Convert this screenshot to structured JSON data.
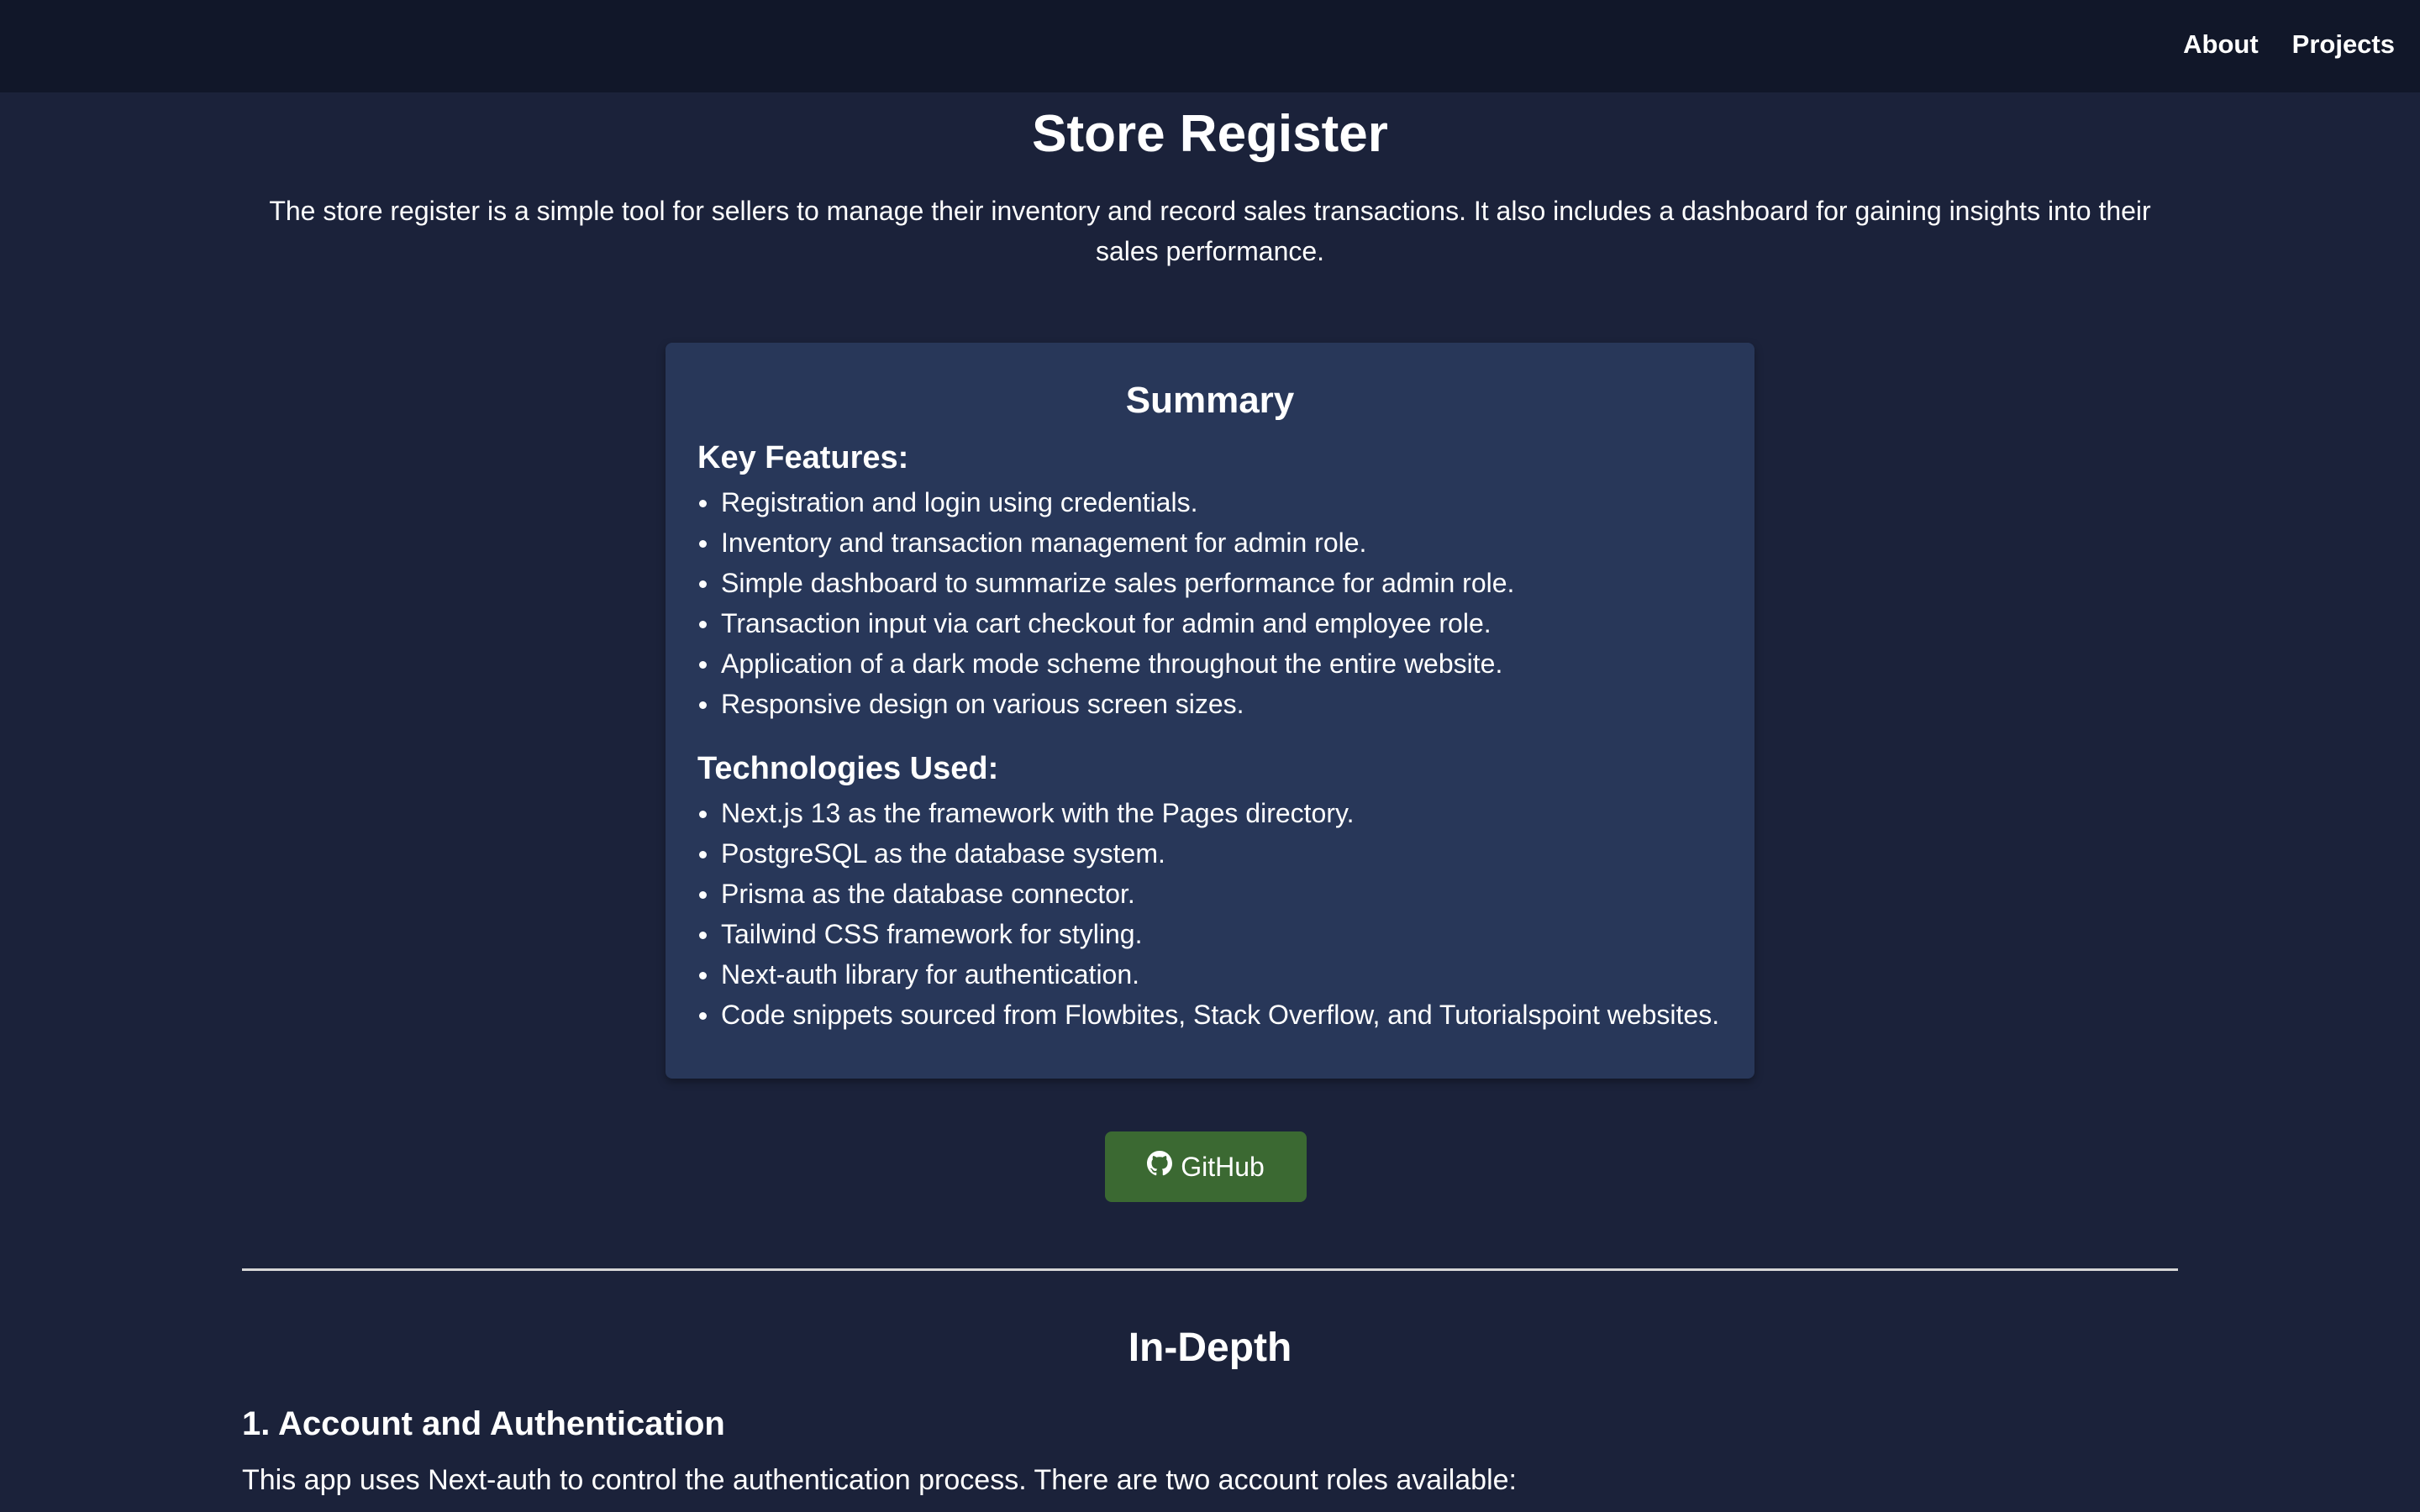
{
  "nav": {
    "about": "About",
    "projects": "Projects"
  },
  "page": {
    "title": "Store Register",
    "intro": "The store register is a simple tool for sellers to manage their inventory and record sales transactions. It also includes a dashboard for gaining insights into their sales performance."
  },
  "summary": {
    "title": "Summary",
    "features_heading": "Key Features:",
    "features": [
      "Registration and login using credentials.",
      "Inventory and transaction management for admin role.",
      "Simple dashboard to summarize sales performance for admin role.",
      "Transaction input via cart checkout for admin and employee role.",
      "Application of a dark mode scheme throughout the entire website.",
      "Responsive design on various screen sizes."
    ],
    "tech_heading": "Technologies Used:",
    "tech": [
      "Next.js 13 as the framework with the Pages directory.",
      "PostgreSQL as the database system.",
      "Prisma as the database connector.",
      "Tailwind CSS framework for styling.",
      "Next-auth library for authentication.",
      "Code snippets sourced from Flowbites, Stack Overflow, and Tutorialspoint websites."
    ]
  },
  "github_button": {
    "label": "GitHub",
    "icon": "github-icon"
  },
  "indepth": {
    "title": "In-Depth",
    "section1_heading": "1. Account and Authentication",
    "section1_text": "This app uses Next-auth to control the authentication process. There are two account roles available:"
  },
  "colors": {
    "background": "#1b223a",
    "topbar": "#111729",
    "card": "#283759",
    "button": "#3b6932",
    "text": "#ffffff"
  }
}
